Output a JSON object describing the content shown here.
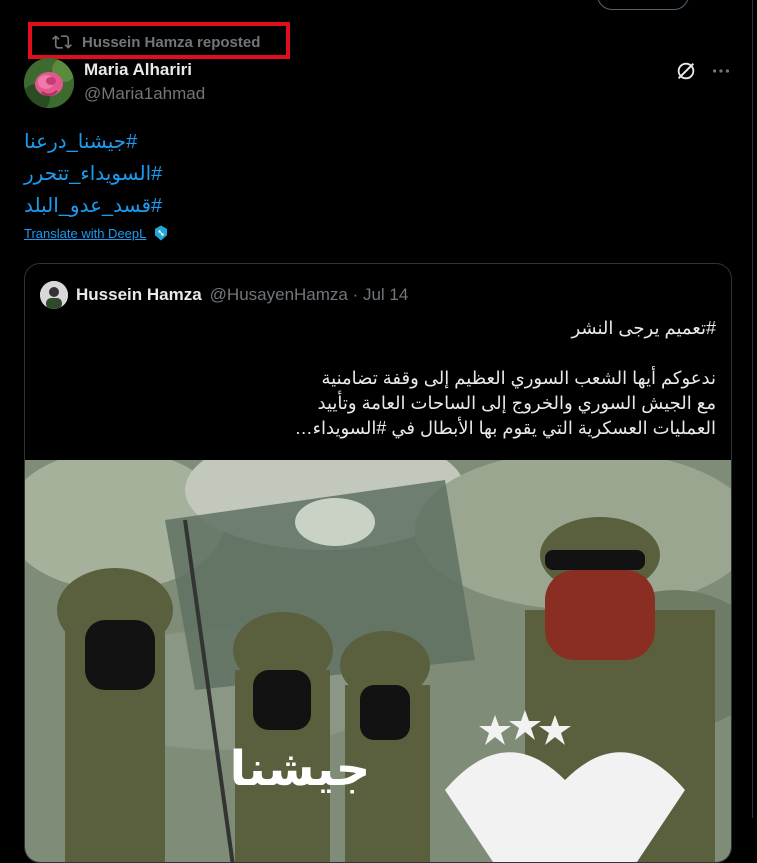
{
  "repost": {
    "text": "Hussein Hamza reposted",
    "icon": "repost-icon"
  },
  "author": {
    "name": "Maria Alhariri",
    "handle": "@Maria1ahmad"
  },
  "post": {
    "hashtags": [
      "#جيشنا_درعنا",
      "#السويداء_تتحرر",
      "#قسد_عدو_البلد"
    ],
    "translate_label": "Translate with DeepL"
  },
  "quote": {
    "name": "Hussein Hamza",
    "meta": "@HusayenHamza · Jul 14",
    "lines": [
      "#تعميم  يرجى النشر",
      "ندعوكم أيها الشعب السوري العظيم إلى وقفة تضامنية",
      "مع الجيش السوري والخروج إلى الساحات العامة وتأييد",
      "العمليات العسكرية التي يقوم بها الأبطال في #السويداء…"
    ],
    "image_caption": "جيشنا"
  },
  "colors": {
    "link": "#1d9bf0",
    "muted": "#71767b",
    "text": "#e7e9ea",
    "highlight": "#e0101a"
  }
}
